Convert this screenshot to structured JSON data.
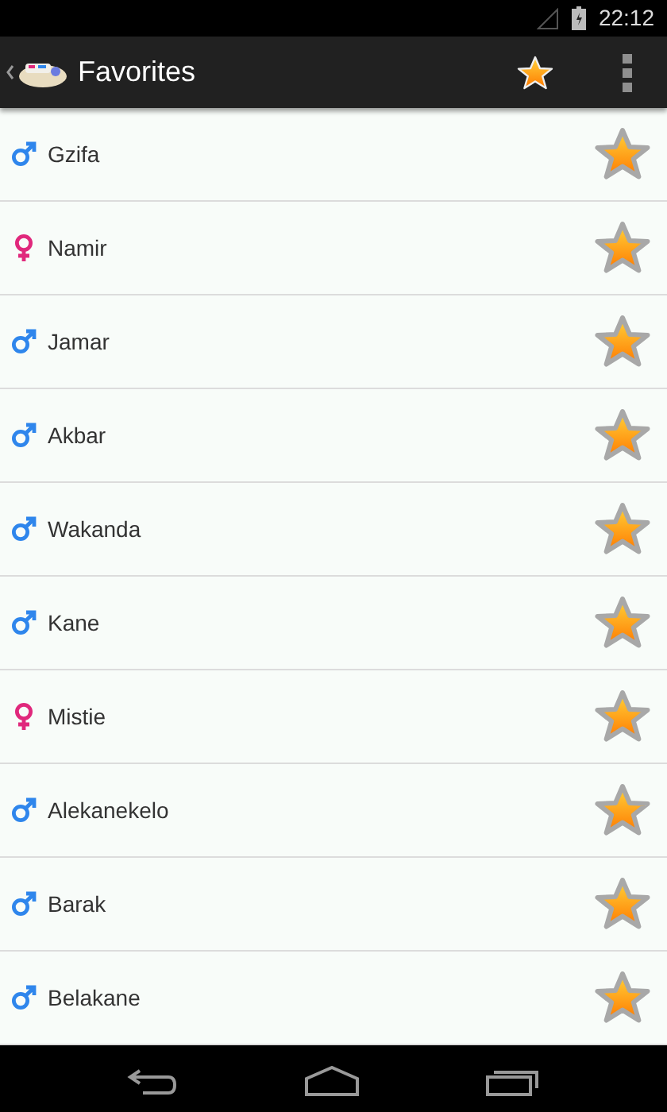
{
  "status_bar": {
    "time": "22:12"
  },
  "app_bar": {
    "title": "Favorites"
  },
  "rows": [
    {
      "name": "Gzifa",
      "kind": "male",
      "favorite": true
    },
    {
      "name": "Namir",
      "kind": "female",
      "favorite": true
    },
    {
      "name": "Jamar",
      "kind": "male",
      "favorite": true
    },
    {
      "name": "Akbar",
      "kind": "male",
      "favorite": true
    },
    {
      "name": "Wakanda",
      "kind": "male",
      "favorite": true
    },
    {
      "name": "Kane",
      "kind": "male",
      "favorite": true
    },
    {
      "name": "Mistie",
      "kind": "female",
      "favorite": true
    },
    {
      "name": "Alekanekelo",
      "kind": "male",
      "favorite": true
    },
    {
      "name": "Barak",
      "kind": "male",
      "favorite": true
    },
    {
      "name": "Belakane",
      "kind": "male",
      "favorite": true
    }
  ]
}
